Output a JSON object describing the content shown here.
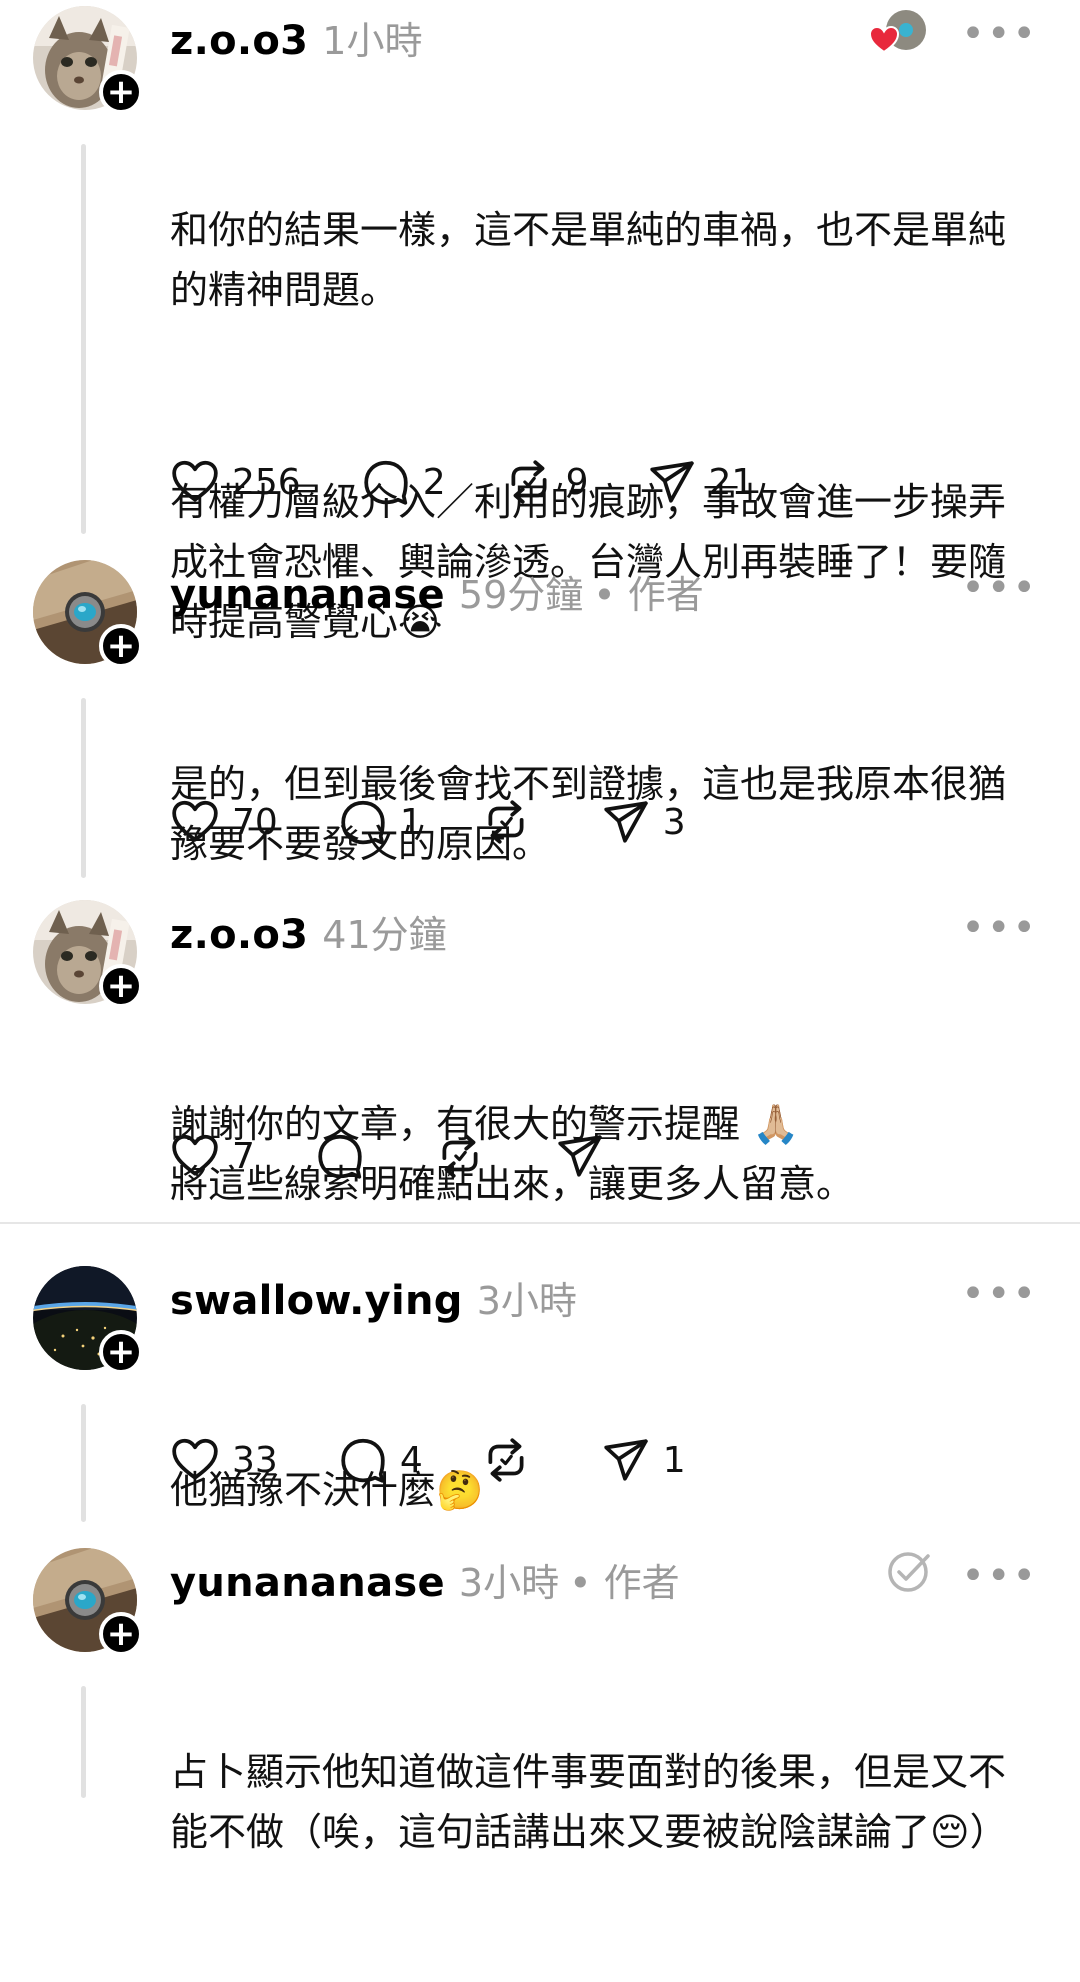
{
  "posts": [
    {
      "username": "z.o.o3",
      "time": "1小時",
      "author_tag": "",
      "paragraphs": [
        "和你的結果一樣，這不是單純的車禍，也不是單純的精神問題。",
        "有權力層級介入／利用的痕跡，事故會進一步操弄成社會恐懼、輿論滲透。台灣人別再裝睡了！要隨時提高警覺心😭"
      ],
      "likes": "256",
      "replies": "2",
      "reposts": "9",
      "shares": "21",
      "avatar": "cat-avatar"
    },
    {
      "username": "yunananase",
      "time": "59分鐘",
      "author_tag": "• 作者",
      "paragraphs": [
        "是的，但到最後會找不到證據，這也是我原本很猶豫要不要發文的原因。"
      ],
      "likes": "70",
      "replies": "1",
      "reposts": "",
      "shares": "3",
      "avatar": "gem-avatar"
    },
    {
      "username": "z.o.o3",
      "time": "41分鐘",
      "author_tag": "",
      "paragraphs": [
        "謝謝你的文章，有很大的警示提醒 🙏🏼\n將這些線索明確點出來，讓更多人留意。"
      ],
      "likes": "7",
      "replies": "",
      "reposts": "",
      "shares": "",
      "avatar": "cat-avatar"
    },
    {
      "username": "swallow.ying",
      "time": "3小時",
      "author_tag": "",
      "paragraphs": [
        "他猶豫不決什麼🤔"
      ],
      "likes": "33",
      "replies": "4",
      "reposts": "",
      "shares": "1",
      "avatar": "earth-night-avatar"
    },
    {
      "username": "yunananase",
      "time": "3小時",
      "author_tag": "• 作者",
      "paragraphs": [
        "占卜顯示他知道做這件事要面對的後果，但是又不能不做（唉，這句話講出來又要被說陰謀論了😔）"
      ],
      "likes": "",
      "replies": "",
      "reposts": "",
      "shares": "",
      "avatar": "gem-avatar"
    }
  ],
  "icons": {
    "more": "•••",
    "follow": "+",
    "like": "heart-icon",
    "reply": "speech-bubble-icon",
    "repost": "repost-icon",
    "share": "paper-plane-icon"
  },
  "colors": {
    "text": "#111111",
    "meta": "#9a9a9a",
    "heart_red": "#e8283c",
    "thread_line": "#e1e1e1"
  }
}
